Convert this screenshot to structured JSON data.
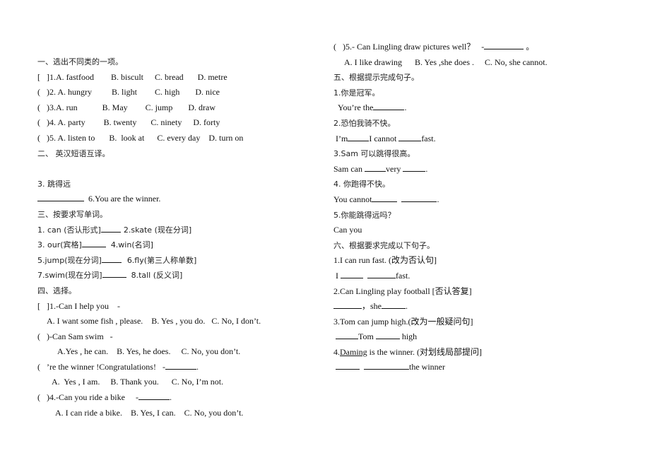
{
  "left": {
    "sec1": {
      "title": "一、选出不同类的一项。",
      "items": [
        {
          "bracket": "[   ]",
          "text": "1.A. fastfood",
          "b": "B. biscult",
          "c": "C. bread",
          "d": "D. metre"
        },
        {
          "bracket": "(   )",
          "text": "2. A. hungry",
          "b": "B. light",
          "c": "C. high",
          "d": "D. nice"
        },
        {
          "bracket": "(   )",
          "text": "3.A. run",
          "b": "B. May",
          "c": "C. jump",
          "d": "D. draw"
        },
        {
          "bracket": "(   )",
          "text": "4. A. party",
          "b": "B. twenty",
          "c": "C. ninety",
          "d": "D. forty"
        },
        {
          "bracket": "(   )",
          "text": "5. A. listen to",
          "b": "B.  look at",
          "c": "C. every day",
          "d": "D. turn on"
        }
      ]
    },
    "sec2": {
      "title": "二、 英汉短语互译。",
      "item3": "3. 跳得远",
      "item6": "6.You are the winner."
    },
    "sec3": {
      "title": "三、按要求写单词。",
      "rows": [
        {
          "a": "1. can (否认形式]",
          "b": "2.skate (现在分词]"
        },
        {
          "a": "3. our(宾格]",
          "b": "4.win(名词]"
        },
        {
          "a": "5.jump(现在分词]",
          "b": "6.fly(第三人称单数]"
        },
        {
          "a": "7.swim(现在分词]",
          "b": "8.tall (反义词]"
        }
      ]
    },
    "sec4": {
      "title": "四、选择。",
      "q1": {
        "bracket": "[   ]",
        "text": "1.-Can I help you    -",
        "opts": "A. I want some fish , please.    B. Yes , you do.   C. No, I don’t."
      },
      "q2": {
        "bracket": "(   ",
        "text": ")-Can Sam swim   -",
        "opts": "A.Yes , he can.    B. Yes, he does.     C. No, you don’t."
      },
      "q3": {
        "bracket": "(   ",
        "text": "’re the winner !Congratulations!   -",
        "end": ".",
        "opts": "A.  Yes , I am.     B. Thank you.      C. No, I’m not."
      },
      "q4": {
        "bracket": "(   ",
        "text": ")4.-Can you ride a bike     -",
        "end": ".",
        "opts": "A. I can ride a bike.    B. Yes, I can.    C. No, you don’t."
      }
    }
  },
  "right": {
    "q5": {
      "bracket": "(   ",
      "text": ")5.- Can Lingling draw pictures well？   -",
      "end": " 。",
      "opts": "A. I like drawing      B. Yes ,she does .     C. No, she cannot."
    },
    "sec5": {
      "title": "五、根据提示完成句子。",
      "items": [
        {
          "cn": "1.你是冠军。",
          "en_a": "You’re the",
          "en_end": "."
        },
        {
          "cn": "2.恐怕我骑不快。",
          "en_a": "I’m",
          "en_b": "I cannot ",
          "en_end": "fast."
        },
        {
          "cn": "3.Sam 可以跳得很高。",
          "en_a": "Sam can ",
          "en_b": "very ",
          "en_end": "."
        },
        {
          "cn": "4. 你跑得不快。",
          "en_a": "You cannot",
          "en_end": "."
        },
        {
          "cn": "5.你能跳得远吗？",
          "en_a": "Can you"
        }
      ]
    },
    "sec6": {
      "title": "六、根据要求完成以下句子。",
      "items": [
        {
          "q": "1.I can run fast. (改为否认句]",
          "a_start": "I ",
          "a_end": "fast."
        },
        {
          "q": "2.Can Lingling play football [否认答复]",
          "a_mid": "，she",
          "a_end": "."
        },
        {
          "q": "3.Tom can jump high.(改为一般疑问句]",
          "a_mid": "Tom ",
          "a_end": " high"
        },
        {
          "q_pre": "4.",
          "q_u": "Daming",
          "q_post": " is the winner. (对划线局部提问]",
          "a_end": "the winner"
        }
      ]
    }
  }
}
